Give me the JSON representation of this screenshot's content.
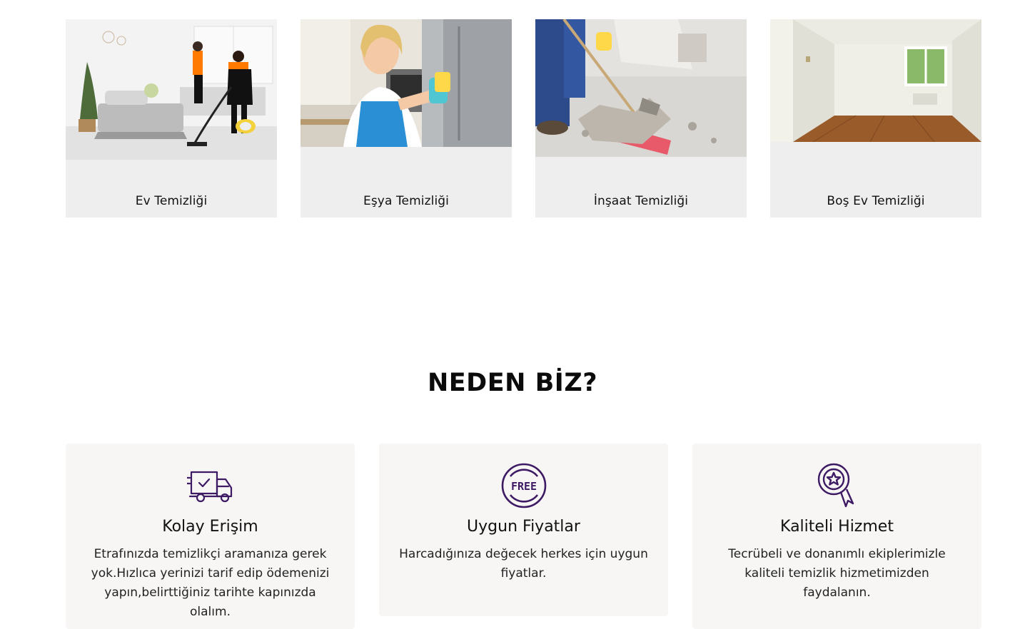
{
  "services": [
    {
      "title": "Ev Temizliği",
      "image": "ev-temizligi-photo"
    },
    {
      "title": "Eşya Temizliği",
      "image": "esya-temizligi-photo"
    },
    {
      "title": "İnşaat Temizliği",
      "image": "insaat-temizligi-photo"
    },
    {
      "title": "Boş Ev Temizliği",
      "image": "bos-ev-temizligi-photo"
    }
  ],
  "why": {
    "title": "NEDEN BİZ?",
    "features": [
      {
        "title": "Kolay Erişim",
        "text": "Etrafınızda temizlikçi aramanıza gerek yok.Hızlıca yerinizi tarif edip ödemenizi yapın,belirttiğiniz tarihte kapınızda olalım.",
        "icon": "delivery-truck-icon"
      },
      {
        "title": "Uygun Fiyatlar",
        "text": "Harcadığınıza değecek herkes için uygun fiyatlar.",
        "icon": "free-badge-icon",
        "badge_text": "FREE"
      },
      {
        "title": "Kaliteli Hizmet",
        "text": "Tecrübeli ve donanımlı ekiplerimizle kaliteli temizlik hizmetimizden faydalanın.",
        "icon": "award-ribbon-icon"
      }
    ]
  },
  "colors": {
    "accent": "#3d1a63",
    "card_bg": "#eeeeee",
    "feature_bg": "#f7f6f5"
  }
}
